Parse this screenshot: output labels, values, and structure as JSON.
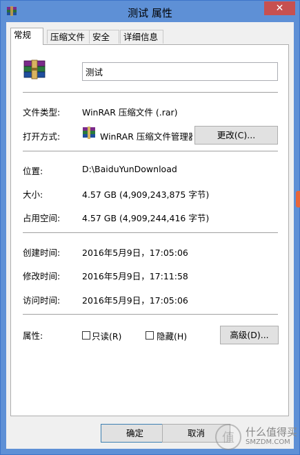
{
  "window": {
    "title": "测试 属性",
    "close_label": "✕"
  },
  "tabs": [
    {
      "label": "常规",
      "active": true
    },
    {
      "label": "压缩文件",
      "active": false
    },
    {
      "label": "安全",
      "active": false
    },
    {
      "label": "详细信息",
      "active": false
    }
  ],
  "general": {
    "name_value": "测试",
    "type_label": "文件类型:",
    "type_value": "WinRAR 压缩文件 (.rar)",
    "open_with_label": "打开方式:",
    "open_with_value": "WinRAR 压缩文件管理器",
    "change_button": "更改(C)...",
    "location_label": "位置:",
    "location_value": "D:\\BaiduYunDownload",
    "size_label": "大小:",
    "size_value": "4.57 GB (4,909,243,875 字节)",
    "size_on_disk_label": "占用空间:",
    "size_on_disk_value": "4.57 GB (4,909,244,416 字节)",
    "created_label": "创建时间:",
    "created_value": "2016年5月9日，17:05:06",
    "modified_label": "修改时间:",
    "modified_value": "2016年5月9日，17:11:58",
    "accessed_label": "访问时间:",
    "accessed_value": "2016年5月9日，17:05:06",
    "attributes_label": "属性:",
    "readonly_label": "只读(R)",
    "hidden_label": "隐藏(H)",
    "advanced_button": "高级(D)..."
  },
  "buttons": {
    "ok": "确定",
    "cancel": "取消"
  },
  "watermark": {
    "text_top": "什么值得买",
    "text_bottom": "SMZDM.COM"
  },
  "colors": {
    "titlebar": "#5e90d6",
    "close": "#c75050",
    "panel": "#ffffff",
    "client": "#f0f0f0"
  }
}
